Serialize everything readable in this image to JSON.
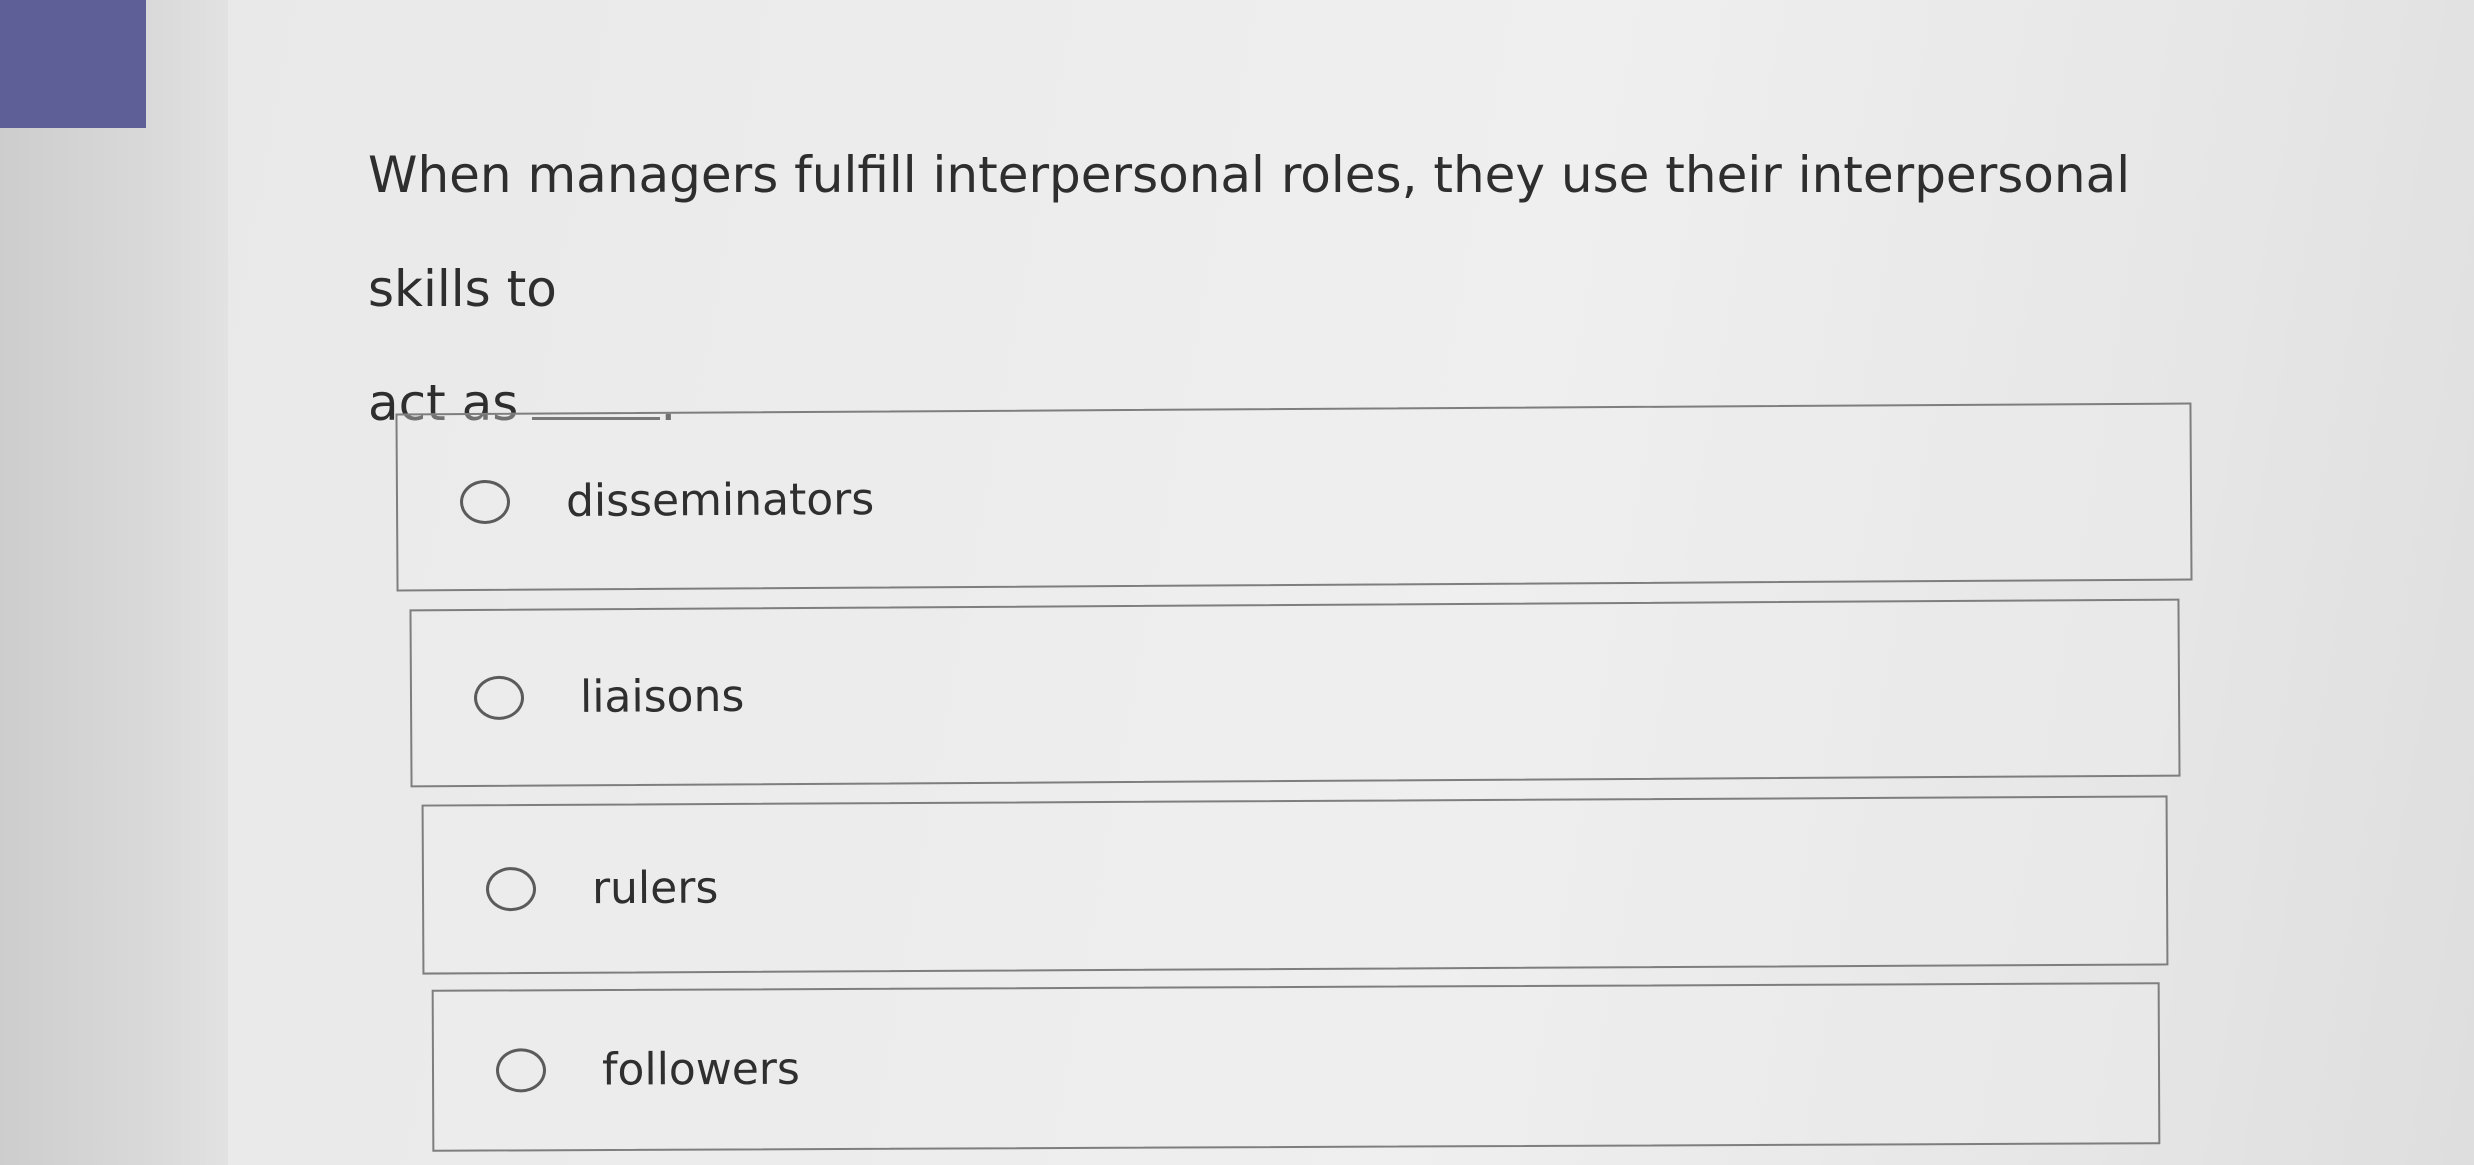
{
  "question": {
    "line1": "When managers fulfill interpersonal roles, they use their interpersonal skills to",
    "line2": "act as",
    "end_punct": "."
  },
  "options": [
    {
      "label": "disseminators",
      "selected": false
    },
    {
      "label": "liaisons",
      "selected": false
    },
    {
      "label": "rulers",
      "selected": false
    },
    {
      "label": "followers",
      "selected": false
    }
  ]
}
